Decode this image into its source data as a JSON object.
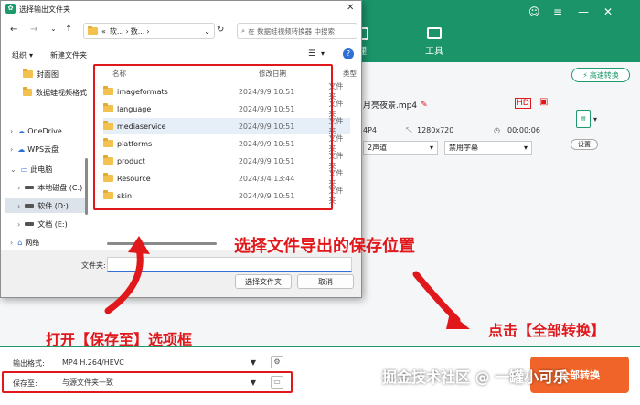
{
  "app": {
    "tab_partial": "理",
    "tab_tools": "工具",
    "fast_convert": "高速转换",
    "file_title_partial": "月亮夜景.mp4",
    "format_partial": "4P4",
    "resolution": "1280x720",
    "duration": "00:00:06",
    "audio_partial": "2声道",
    "subtitle": "禁用字幕",
    "settings": "设置",
    "output_format_label": "输出格式:",
    "output_format_value": "MP4 H.264/HEVC",
    "save_to_label": "保存至:",
    "save_to_value": "与源文件夹一致",
    "convert_all_partial": "全部转换"
  },
  "dialog": {
    "title": "选择输出文件夹",
    "breadcrumb": [
      "«",
      "软...",
      "数..."
    ],
    "search_placeholder": "在 数据蛙视频转换器 中搜索",
    "organize": "组织",
    "new_folder": "新建文件夹",
    "columns": {
      "name": "名称",
      "modified": "修改日期",
      "type": "类型"
    },
    "nav": [
      {
        "label": "封面图",
        "kind": "folder"
      },
      {
        "label": "数据蛙视频格式",
        "kind": "folder"
      },
      {
        "label": "OneDrive",
        "kind": "cloud"
      },
      {
        "label": "WPS云盘",
        "kind": "cloud"
      },
      {
        "label": "此电脑",
        "kind": "pc"
      },
      {
        "label": "本地磁盘 (C:)",
        "kind": "drive"
      },
      {
        "label": "软件 (D:)",
        "kind": "drive"
      },
      {
        "label": "文档 (E:)",
        "kind": "drive"
      },
      {
        "label": "网络",
        "kind": "net"
      }
    ],
    "files": [
      {
        "name": "imageformats",
        "date": "2024/9/9 10:51",
        "type": "文件夹"
      },
      {
        "name": "language",
        "date": "2024/9/9 10:51",
        "type": "文件夹"
      },
      {
        "name": "mediaservice",
        "date": "2024/9/9 10:51",
        "type": "文件夹"
      },
      {
        "name": "platforms",
        "date": "2024/9/9 10:51",
        "type": "文件夹"
      },
      {
        "name": "product",
        "date": "2024/9/9 10:51",
        "type": "文件夹"
      },
      {
        "name": "Resource",
        "date": "2024/3/4 13:44",
        "type": "文件夹"
      },
      {
        "name": "skin",
        "date": "2024/9/9 10:51",
        "type": "文件夹"
      }
    ],
    "folder_label": "文件夹:",
    "select_button": "选择文件夹",
    "cancel_button": "取消"
  },
  "annotations": {
    "choose_location": "选择文件导出的保存位置",
    "open_save_to": "打开【保存至】选项框",
    "click_convert_all": "点击【全部转换】"
  },
  "watermark": "掘金技术社区 @ 一罐小可乐",
  "colors": {
    "brand_green": "#1f9a6c",
    "annotation_red": "#e0181b",
    "convert_orange": "#f0642a"
  }
}
